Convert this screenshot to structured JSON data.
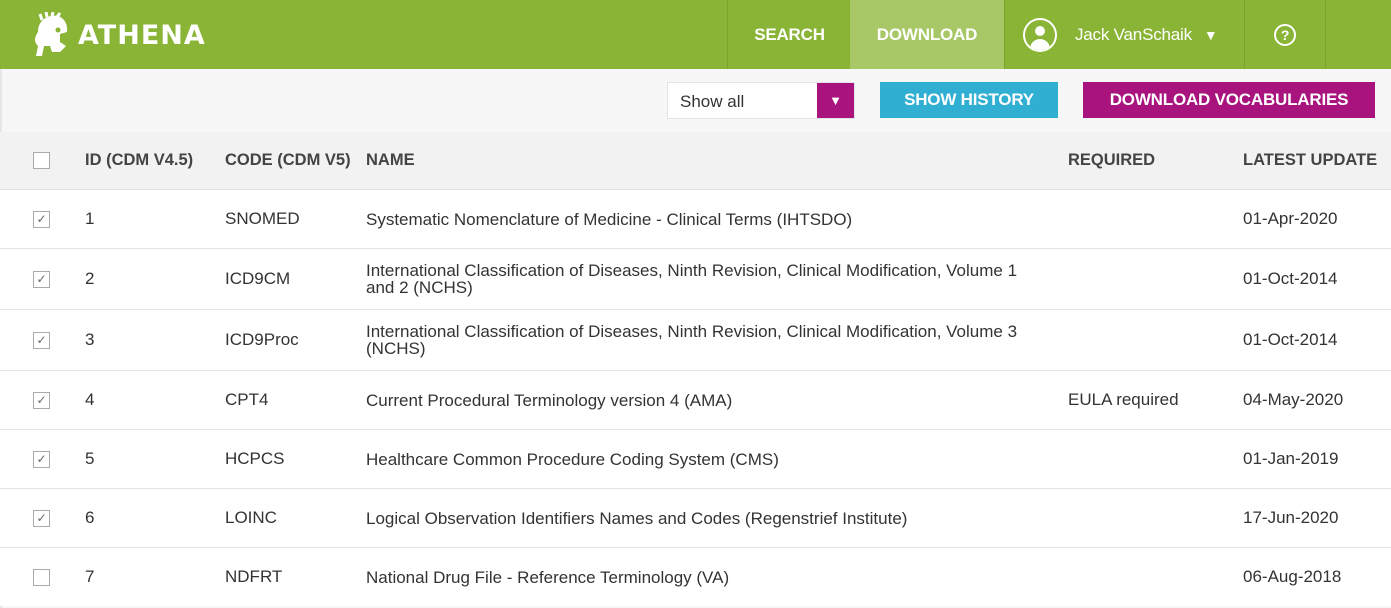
{
  "app": {
    "brand": "ATHENA"
  },
  "nav": {
    "search": "SEARCH",
    "download": "DOWNLOAD",
    "user_name": "Jack VanSchaik",
    "help_glyph": "?"
  },
  "toolbar": {
    "filter_value": "Show all",
    "show_history": "SHOW HISTORY",
    "download_vocabularies": "DOWNLOAD VOCABULARIES"
  },
  "table": {
    "headers": {
      "id": "ID (CDM V4.5)",
      "code": "CODE (CDM V5)",
      "name": "NAME",
      "required": "REQUIRED",
      "latest_update": "LATEST UPDATE"
    },
    "rows": [
      {
        "checked": true,
        "id": "1",
        "code": "SNOMED",
        "name": "Systematic Nomenclature of Medicine - Clinical Terms (IHTSDO)",
        "required": "",
        "latest_update": "01-Apr-2020"
      },
      {
        "checked": true,
        "id": "2",
        "code": "ICD9CM",
        "name": "International Classification of Diseases, Ninth Revision, Clinical Modification, Volume 1 and 2 (NCHS)",
        "required": "",
        "latest_update": "01-Oct-2014"
      },
      {
        "checked": true,
        "id": "3",
        "code": "ICD9Proc",
        "name": "International Classification of Diseases, Ninth Revision, Clinical Modification, Volume 3 (NCHS)",
        "required": "",
        "latest_update": "01-Oct-2014"
      },
      {
        "checked": true,
        "id": "4",
        "code": "CPT4",
        "name": "Current Procedural Terminology version 4 (AMA)",
        "required": "EULA required",
        "latest_update": "04-May-2020"
      },
      {
        "checked": true,
        "id": "5",
        "code": "HCPCS",
        "name": "Healthcare Common Procedure Coding System (CMS)",
        "required": "",
        "latest_update": "01-Jan-2019"
      },
      {
        "checked": true,
        "id": "6",
        "code": "LOINC",
        "name": "Logical Observation Identifiers Names and Codes (Regenstrief Institute)",
        "required": "",
        "latest_update": "17-Jun-2020"
      },
      {
        "checked": false,
        "id": "7",
        "code": "NDFRT",
        "name": "National Drug File - Reference Terminology (VA)",
        "required": "",
        "latest_update": "06-Aug-2018"
      }
    ]
  },
  "colors": {
    "header_green": "#8ab436",
    "active_tab": "#a8c868",
    "magenta": "#a8137d",
    "cyan": "#31afd2"
  },
  "icons": [
    "athena-helmet-icon",
    "user-avatar-icon",
    "caret-down-icon",
    "help-icon",
    "checkbox-icon"
  ]
}
